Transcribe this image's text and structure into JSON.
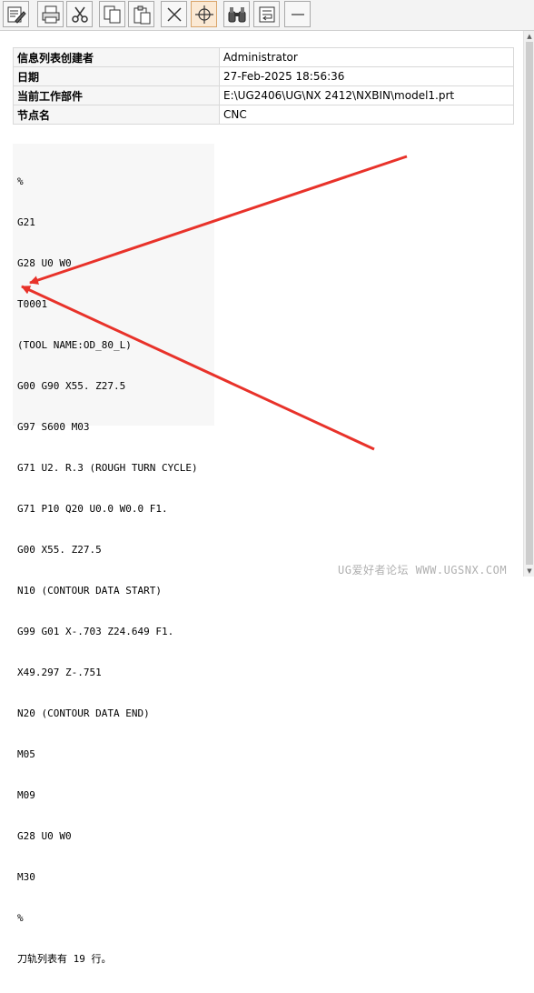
{
  "toolbar": {
    "buttons": [
      {
        "icon": "edit-icon"
      },
      {
        "icon": "print-icon"
      },
      {
        "icon": "cut-icon"
      },
      {
        "icon": "copy-icon"
      },
      {
        "icon": "paste-icon"
      },
      {
        "icon": "delete-icon"
      },
      {
        "icon": "crosshair-icon"
      },
      {
        "icon": "find-icon"
      },
      {
        "icon": "save-icon"
      },
      {
        "icon": "minimize-icon"
      }
    ]
  },
  "info_table": {
    "rows": [
      {
        "key": "信息列表创建者",
        "value": "Administrator"
      },
      {
        "key": "日期",
        "value": "27-Feb-2025 18:56:36"
      },
      {
        "key": "当前工作部件",
        "value": "E:\\UG2406\\UG\\NX 2412\\NXBIN\\model1.prt"
      },
      {
        "key": "节点名",
        "value": "CNC"
      }
    ]
  },
  "code_lines": [
    "%",
    "G21",
    "G28 U0 W0",
    "T0001",
    "(TOOL NAME:OD_80_L)",
    "G00 G90 X55. Z27.5",
    "G97 S600 M03",
    "G71 U2. R.3 (ROUGH TURN CYCLE)",
    "G71 P10 Q20 U0.0 W0.0 F1.",
    "G00 X55. Z27.5",
    "N10 (CONTOUR DATA START)",
    "G99 G01 X-.703 Z24.649 F1.",
    "X49.297 Z-.751",
    "N20 (CONTOUR DATA END)",
    "M05",
    "M09",
    "G28 U0 W0",
    "M30",
    "%",
    "刀轨列表有 19 行。"
  ],
  "annotation_color": "#e8322a",
  "watermark": "UG爱好者论坛 WWW.UGSNX.COM"
}
